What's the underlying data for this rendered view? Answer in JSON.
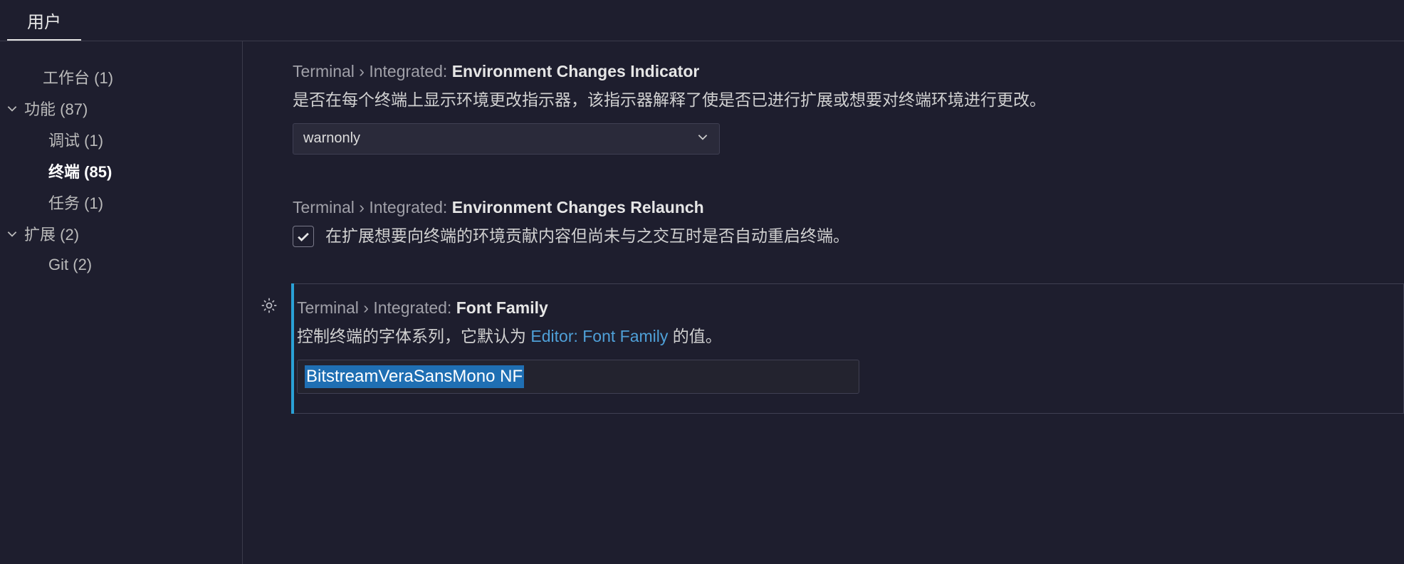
{
  "tabs": {
    "user": "用户"
  },
  "sidebar": {
    "workbench": {
      "label": "工作台",
      "count": "(1)"
    },
    "features": {
      "label": "功能",
      "count": "(87)"
    },
    "debug": {
      "label": "调试",
      "count": "(1)"
    },
    "terminal": {
      "label": "终端",
      "count": "(85)"
    },
    "tasks": {
      "label": "任务",
      "count": "(1)"
    },
    "extensions": {
      "label": "扩展",
      "count": "(2)"
    },
    "git": {
      "label": "Git",
      "count": "(2)"
    }
  },
  "settings": {
    "envChangesIndicator": {
      "scope": "Terminal › Integrated: ",
      "name": "Environment Changes Indicator",
      "desc": "是否在每个终端上显示环境更改指示器，该指示器解释了使是否已进行扩展或想要对终端环境进行更改。",
      "value": "warnonly"
    },
    "envChangesRelaunch": {
      "scope": "Terminal › Integrated: ",
      "name": "Environment Changes Relaunch",
      "desc": "在扩展想要向终端的环境贡献内容但尚未与之交互时是否自动重启终端。",
      "checked": true
    },
    "fontFamily": {
      "scope": "Terminal › Integrated: ",
      "name": "Font Family",
      "descPre": "控制终端的字体系列，它默认为 ",
      "descLink": "Editor: Font Family",
      "descPost": " 的值。",
      "value": "BitstreamVeraSansMono NF"
    }
  }
}
